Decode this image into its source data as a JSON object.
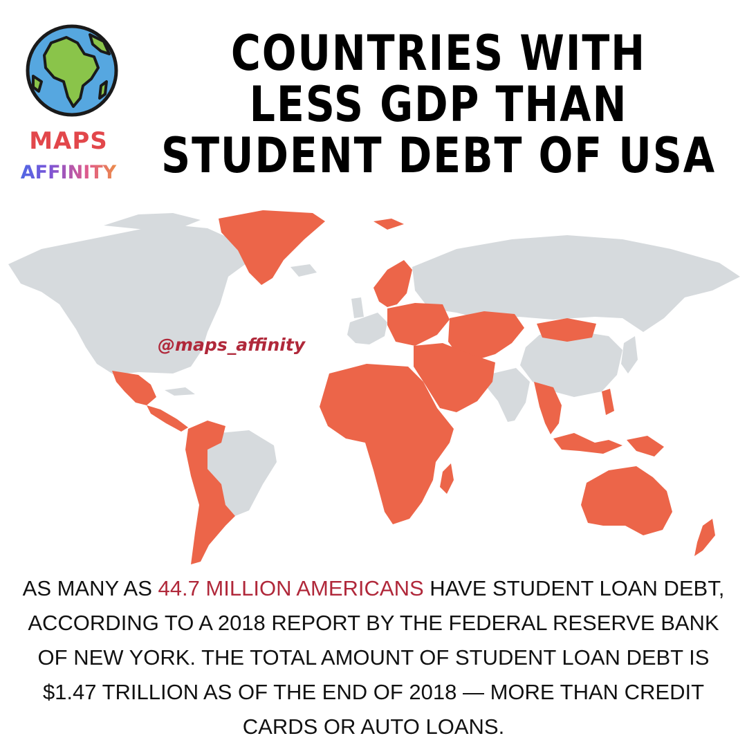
{
  "logo": {
    "line1": "MAPS",
    "line2": "AFFINITY",
    "globe_icon": "globe-africa-icon",
    "colors": {
      "ocean": "#56a7e0",
      "land": "#8ac44a",
      "outline": "#1a1a1a",
      "maps": "#e2474b"
    }
  },
  "title": {
    "line1": "COUNTRIES WITH",
    "line2": "LESS GDP THAN",
    "line3": "STUDENT DEBT OF USA"
  },
  "map": {
    "watermark": "@maps_affinity",
    "colors": {
      "highlight": "#ec6549",
      "other": "#d6dadd"
    },
    "highlighted_regions": [
      "Greenland",
      "Mexico",
      "Central America",
      "South America (except Brazil)",
      "Africa",
      "Middle East",
      "Central Asia",
      "Eastern Europe",
      "Scandinavia",
      "Mongolia",
      "Southeast Asia",
      "Australia",
      "New Zealand"
    ]
  },
  "caption": {
    "part1": "AS MANY AS ",
    "highlight": "44.7 MILLION AMERICANS",
    "part2": " HAVE STUDENT LOAN DEBT, ACCORDING TO A 2018 REPORT BY THE FEDERAL RESERVE BANK OF NEW YORK. THE TOTAL AMOUNT OF STUDENT LOAN DEBT IS $1.47 TRILLION AS OF THE END OF 2018 — MORE THAN CREDIT CARDS OR AUTO LOANS."
  }
}
